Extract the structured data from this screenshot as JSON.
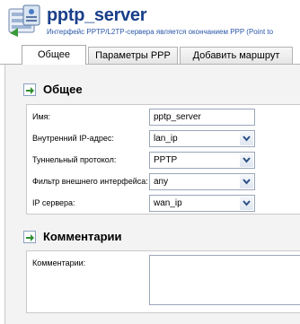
{
  "header": {
    "title": "pptp_server",
    "subtitle": "Интерфейс PPTP/L2TP-сервера является окончанием PPP (Point to"
  },
  "tabs": [
    {
      "label": "Общее",
      "active": true
    },
    {
      "label": "Параметры PPP",
      "active": false
    },
    {
      "label": "Добавить маршрут",
      "active": false
    }
  ],
  "general": {
    "heading": "Общее",
    "fields": [
      {
        "label": "Имя:",
        "value": "pptp_server",
        "type": "text"
      },
      {
        "label": "Внутренний IP-адрес:",
        "value": "lan_ip",
        "type": "select"
      },
      {
        "label": "Туннельный протокол:",
        "value": "PPTP",
        "type": "select"
      },
      {
        "label": "Фильтр внешнего интерфейса:",
        "value": "any",
        "type": "select"
      },
      {
        "label": "IP сервера:",
        "value": "wan_ip",
        "type": "select"
      }
    ]
  },
  "comments": {
    "heading": "Комментарии",
    "label": "Комментарии:",
    "value": ""
  },
  "colors": {
    "title": "#1a3f8a",
    "subtitle": "#2a57a8",
    "panel_bg": "#f3f3f3",
    "section_icon": "#2f8f2f"
  },
  "icons": {
    "app": "server-panel-icon",
    "section": "green-arrow-icon",
    "dropdown": "chevron-down-icon"
  }
}
